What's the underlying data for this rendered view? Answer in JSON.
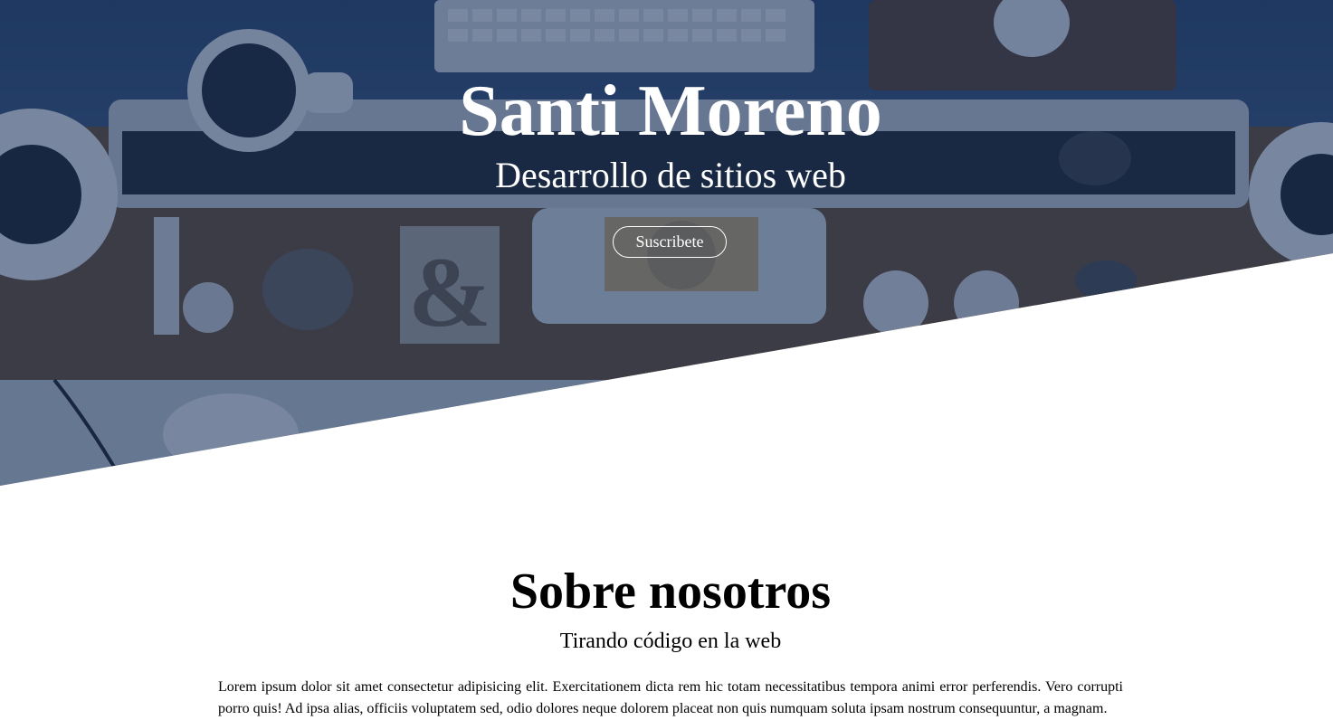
{
  "hero": {
    "title": "Santi Moreno",
    "subtitle": "Desarrollo de sitios web",
    "button_label": "Suscribete",
    "overlay_color": "#16325c"
  },
  "about": {
    "title": "Sobre nosotros",
    "subtitle": "Tirando código en la web",
    "text": "Lorem ipsum dolor sit amet consectetur adipisicing elit. Exercitationem dicta rem hic totam necessitatibus tempora animi error perferendis. Vero corrupti porro quis! Ad ipsa alias, officiis voluptatem sed, odio dolores neque dolorem placeat non quis numquam soluta ipsam nostrum consequuntur, a magnam."
  }
}
